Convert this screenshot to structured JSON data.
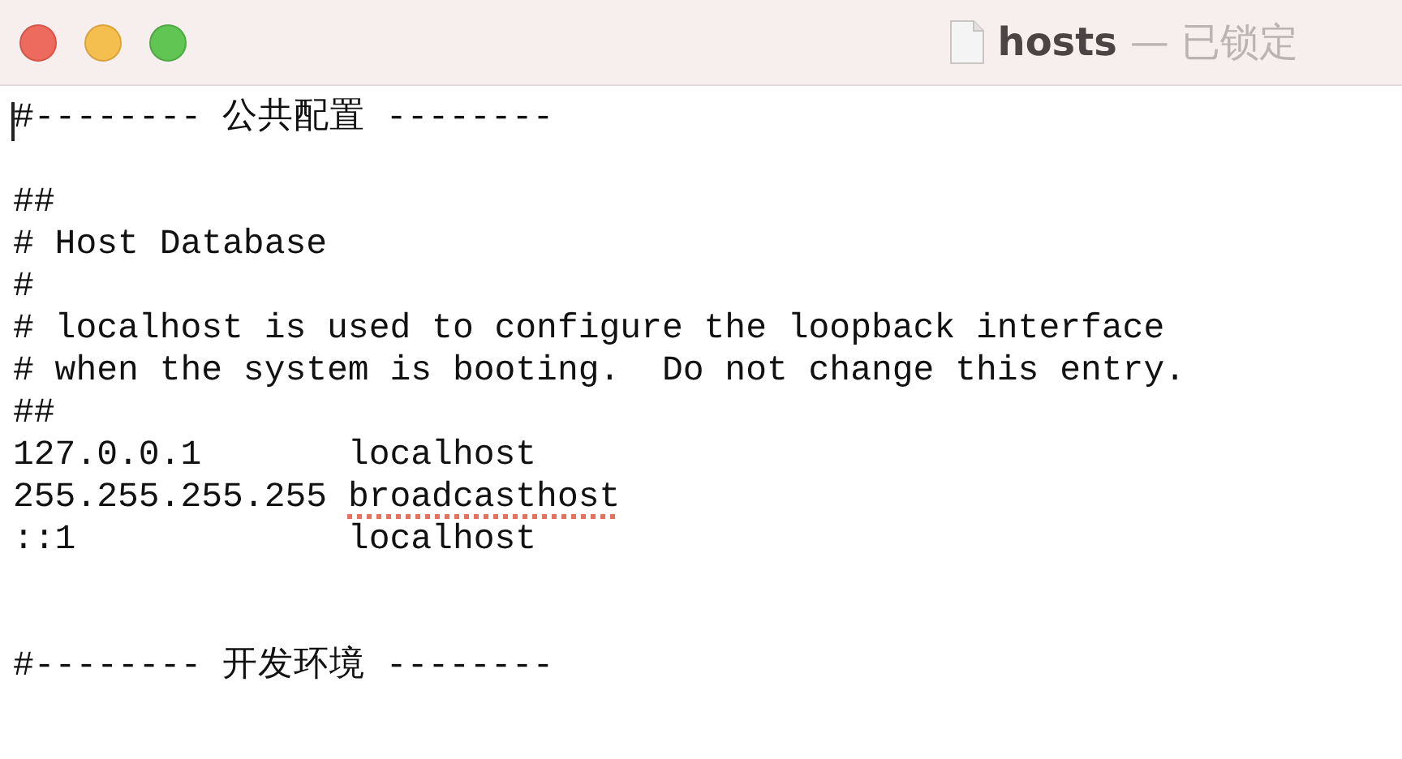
{
  "window": {
    "title": "hosts",
    "status": "— 已锁定"
  },
  "editor": {
    "lines": [
      {
        "kind": "text",
        "segments": [
          {
            "text": "#-------- 公共配置 --------",
            "misspelled": false
          }
        ]
      },
      {
        "kind": "blank"
      },
      {
        "kind": "text",
        "segments": [
          {
            "text": "##",
            "misspelled": false
          }
        ]
      },
      {
        "kind": "text",
        "segments": [
          {
            "text": "# Host Database",
            "misspelled": false
          }
        ]
      },
      {
        "kind": "text",
        "segments": [
          {
            "text": "#",
            "misspelled": false
          }
        ]
      },
      {
        "kind": "text",
        "segments": [
          {
            "text": "# localhost is used to configure the loopback interface",
            "misspelled": false
          }
        ]
      },
      {
        "kind": "text",
        "segments": [
          {
            "text": "# when the system is booting.  Do not change this entry.",
            "misspelled": false
          }
        ]
      },
      {
        "kind": "text",
        "segments": [
          {
            "text": "##",
            "misspelled": false
          }
        ]
      },
      {
        "kind": "text",
        "segments": [
          {
            "text": "127.0.0.1       localhost",
            "misspelled": false
          }
        ]
      },
      {
        "kind": "text",
        "segments": [
          {
            "text": "255.255.255.255 ",
            "misspelled": false
          },
          {
            "text": "broadcasthost",
            "misspelled": true
          }
        ]
      },
      {
        "kind": "text",
        "segments": [
          {
            "text": "::1             localhost",
            "misspelled": false
          }
        ]
      },
      {
        "kind": "blank"
      },
      {
        "kind": "blank"
      },
      {
        "kind": "text",
        "segments": [
          {
            "text": "#-------- 开发环境 --------",
            "misspelled": false
          }
        ]
      }
    ]
  }
}
